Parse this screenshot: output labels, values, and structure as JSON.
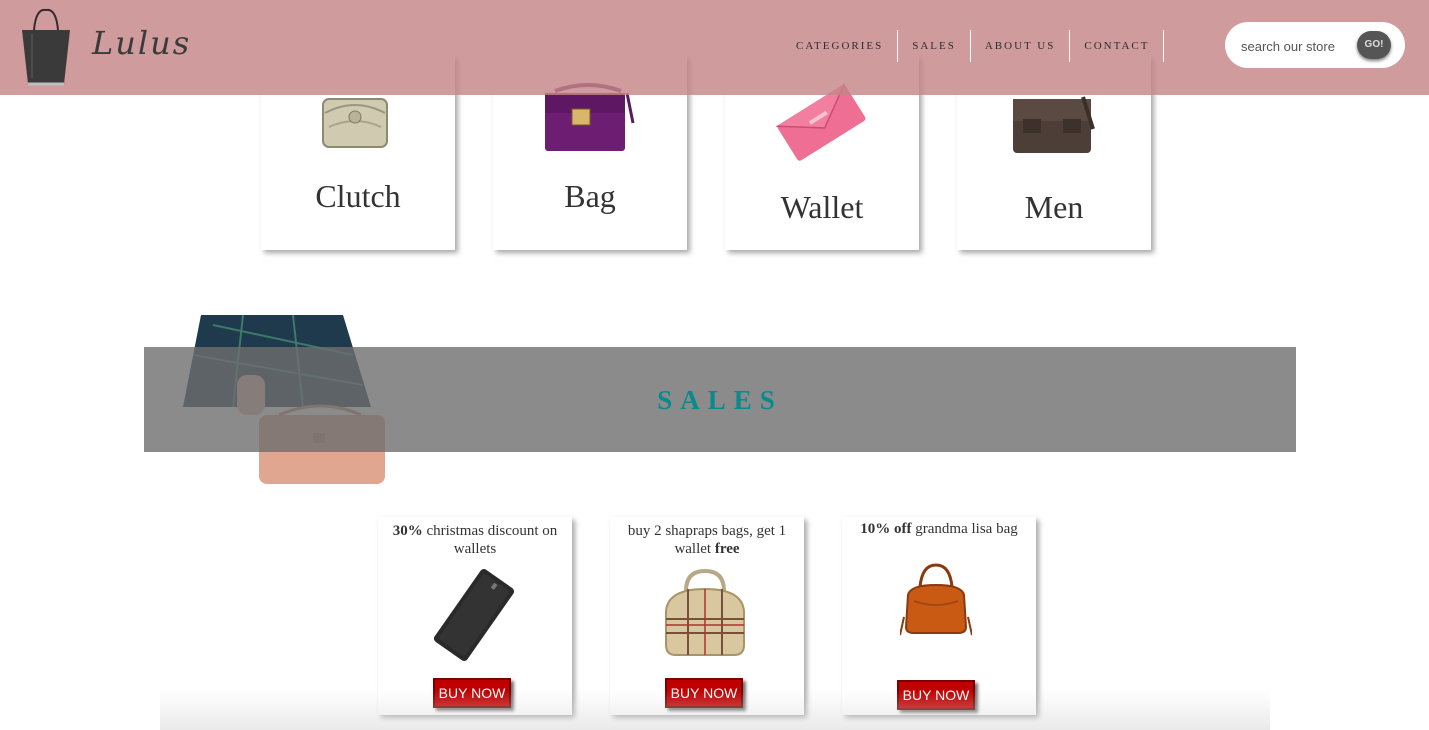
{
  "brand": {
    "name": "Lulus",
    "logo_icon": "handbag-icon"
  },
  "nav": [
    {
      "label": "CATEGORIES"
    },
    {
      "label": "SALES"
    },
    {
      "label": "ABOUT US"
    },
    {
      "label": "CONTACT"
    }
  ],
  "search": {
    "placeholder": "search our store",
    "button_label": "GO!"
  },
  "categories": [
    {
      "label": "Clutch",
      "icon": "clutch-image"
    },
    {
      "label": "Bag",
      "icon": "bag-image"
    },
    {
      "label": "Wallet",
      "icon": "wallet-image"
    },
    {
      "label": "Men",
      "icon": "mens-bag-image"
    }
  ],
  "sales": {
    "title": "SALES",
    "items": [
      {
        "strong": "30%",
        "text": " christmas discount on wallets",
        "button": "BUY NOW"
      },
      {
        "text": "buy 2 shapraps bags, get 1 wallet ",
        "strong": "free",
        "button": "BUY NOW"
      },
      {
        "strong": "10% off",
        "text": " grandma lisa bag",
        "button": "BUY NOW"
      }
    ]
  },
  "colors": {
    "header": "#c48588",
    "sales_title": "#0b8a8e",
    "buy_button": "#c00000"
  }
}
